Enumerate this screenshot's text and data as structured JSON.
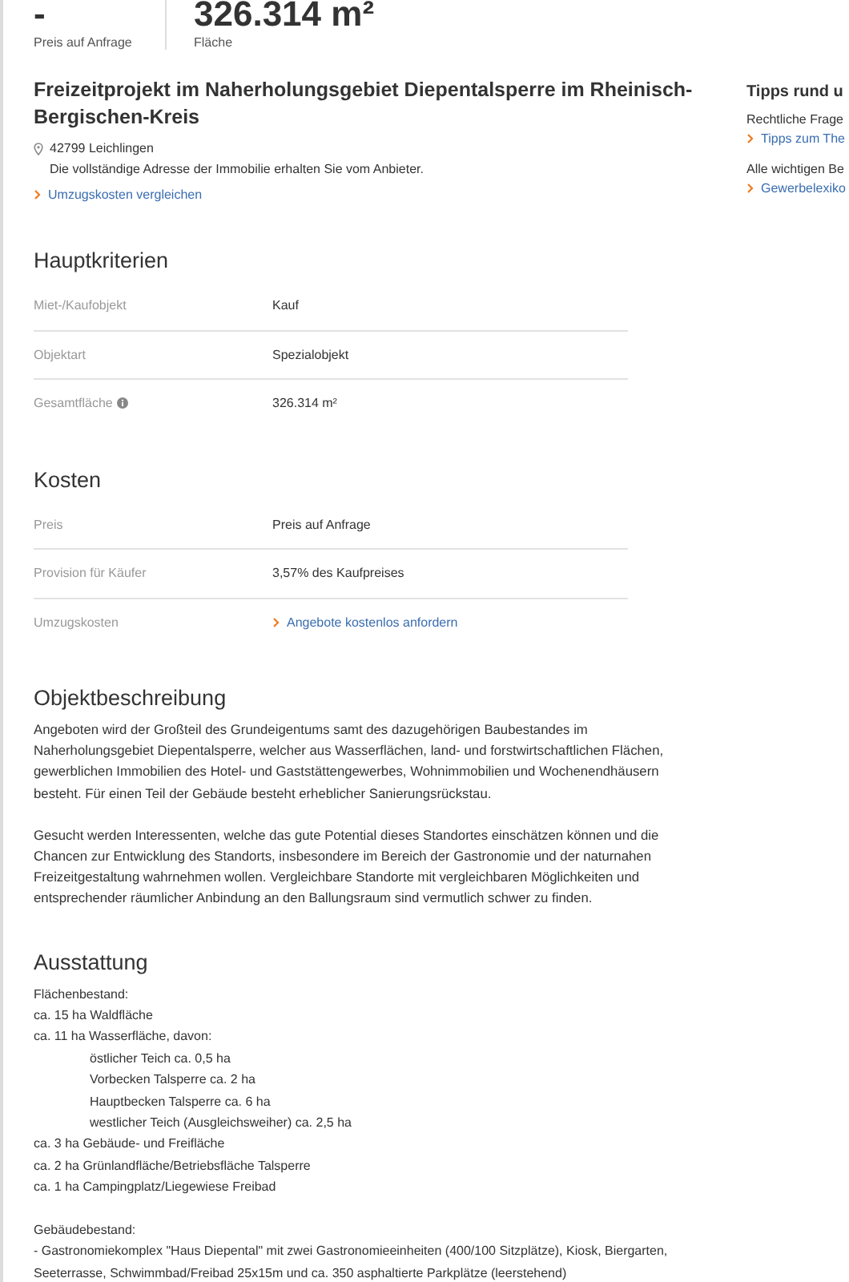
{
  "summary": [
    {
      "value": "-",
      "label": "Preis auf Anfrage"
    },
    {
      "value": "326.314 m²",
      "label": "Fläche"
    }
  ],
  "listing": {
    "title": "Freizeitprojekt im Naherholungsgebiet Diepentalsperre im Rheinisch-Bergischen-Kreis",
    "location": "42799 Leichlingen",
    "address_note": "Die vollständige Adresse der Immobilie erhalten Sie vom Anbieter.",
    "link": "Umzugskosten vergleichen"
  },
  "sections": [
    {
      "kind": "table",
      "heading": "Hauptkriterien",
      "rows": [
        {
          "label": "Miet-/Kaufobjekt",
          "value": "Kauf",
          "info": false,
          "kind": "text"
        },
        {
          "label": "Objektart",
          "value": "Spezialobjekt",
          "info": false,
          "kind": "text"
        },
        {
          "label": "Gesamtfläche",
          "value": "326.314 m²",
          "info": true,
          "kind": "text"
        }
      ]
    },
    {
      "kind": "table",
      "heading": "Kosten",
      "rows": [
        {
          "label": "Preis",
          "value": "Preis auf Anfrage",
          "info": false,
          "kind": "text"
        },
        {
          "label": "Provision für Käufer",
          "value": "3,57% des Kaufpreises",
          "info": false,
          "kind": "text"
        },
        {
          "label": "Umzugskosten",
          "value": "Angebote kostenlos anfordern",
          "info": false,
          "kind": "link"
        }
      ]
    },
    {
      "kind": "text",
      "heading": "Objektbeschreibung",
      "paragraphs": [
        "Angeboten wird der Großteil des Grundeigentums samt des dazugehörigen Baubestandes im Naherholungsgebiet Diepentalsperre, welcher aus Wasserflächen, land- und forstwirtschaftlichen Flächen, gewerblichen Immobilien des Hotel- und Gaststättengewerbes, Wohnimmobilien und Wochenendhäusern besteht. Für einen Teil der Gebäude besteht erheblicher Sanierungsrückstau.",
        "Gesucht werden Interessenten, welche das gute Potential dieses Standortes einschätzen können und die Chancen zur Entwicklung des Standorts, insbesondere im Bereich der Gastronomie und der naturnahen Freizeitgestaltung wahrnehmen wollen. Vergleichbare Standorte mit vergleichbaren Möglichkeiten und entsprechender räumlicher Anbindung an den Ballungsraum sind vermutlich schwer zu finden."
      ]
    },
    {
      "kind": "lines",
      "heading": "Ausstattung",
      "blocks": [
        [
          {
            "text": "Flächenbestand:",
            "indented": false
          },
          {
            "text": "ca. 15 ha Waldfläche",
            "indented": false
          },
          {
            "text": "ca. 11 ha Wasserfläche, davon:",
            "indented": false
          },
          {
            "text": "östlicher Teich ca. 0,5 ha",
            "indented": true
          },
          {
            "text": "Vorbecken Talsperre ca. 2 ha",
            "indented": true
          },
          {
            "text": "Hauptbecken Talsperre ca. 6 ha",
            "indented": true
          },
          {
            "text": "westlicher Teich (Ausgleichsweiher) ca. 2,5 ha",
            "indented": true
          },
          {
            "text": "ca. 3 ha Gebäude- und Freifläche",
            "indented": false
          },
          {
            "text": "ca. 2 ha Grünlandfläche/Betriebsfläche Talsperre",
            "indented": false
          },
          {
            "text": "ca. 1 ha Campingplatz/Liegewiese Freibad",
            "indented": false
          }
        ],
        [
          {
            "text": "Gebäudebestand:",
            "indented": false
          },
          {
            "text": "- Gastronomiekomplex \"Haus Diepental\" mit zwei Gastronomieeinheiten (400/100 Sitzplätze), Kiosk, Biergarten, Seeterrasse, Schwimmbad/Freibad 25x15m und ca. 350 asphaltierte Parkplätze (leerstehend)",
            "indented": false
          }
        ]
      ]
    }
  ],
  "sidebar": {
    "heading": "Tipps rund u",
    "groups": [
      {
        "text": "Rechtliche Frage",
        "link": "Tipps zum The"
      },
      {
        "text": "Alle wichtigen Be",
        "link": "Gewerbelexiko"
      }
    ]
  }
}
